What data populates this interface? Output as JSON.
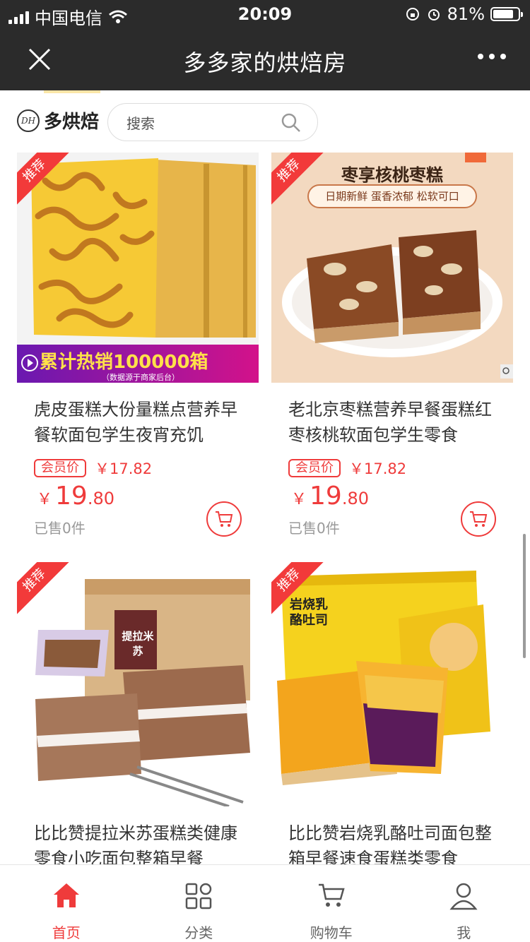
{
  "status_bar": {
    "carrier": "中国电信",
    "time": "20:09",
    "battery": "81%",
    "battery_level": 0.81
  },
  "title_bar": {
    "title": "多多家的烘焙房"
  },
  "header": {
    "logo_text": "多烘焙",
    "search_placeholder": "搜索"
  },
  "products": [
    {
      "tag": "推荐",
      "name": "虎皮蛋糕大份量糕点营养早餐软面包学生夜宵充饥",
      "member_label": "会员价",
      "member_price": "￥17.82",
      "price_symbol": "￥",
      "price_int": "19",
      "price_dec": ".80",
      "sold": "已售0件",
      "banner_text": "累计热销100000箱",
      "banner_sub": "（数据源于商家后台）"
    },
    {
      "tag": "推荐",
      "name": "老北京枣糕营养早餐蛋糕红枣核桃软面包学生零食",
      "member_label": "会员价",
      "member_price": "￥17.82",
      "price_symbol": "￥",
      "price_int": "19",
      "price_dec": ".80",
      "sold": "已售0件",
      "image_title": "枣享核桃枣糕",
      "image_sub": "日期新鲜  蛋香浓郁  松软可口"
    },
    {
      "tag": "推荐",
      "name": "比比赞提拉米苏蛋糕类健康零食小吃面包整箱早餐",
      "box_text": "提拉米苏"
    },
    {
      "tag": "推荐",
      "name": "比比赞岩烧乳酪吐司面包整箱早餐速食蛋糕类零食",
      "box_text": "岩烧乳酪吐司"
    }
  ],
  "bottom_nav": [
    {
      "label": "首页",
      "icon": "home-icon",
      "active": true
    },
    {
      "label": "分类",
      "icon": "category-icon",
      "active": false
    },
    {
      "label": "购物车",
      "icon": "cart-icon",
      "active": false
    },
    {
      "label": "我",
      "icon": "user-icon",
      "active": false
    }
  ],
  "colors": {
    "accent": "#ef3b3b",
    "top_bar": "#2b2b2b"
  }
}
